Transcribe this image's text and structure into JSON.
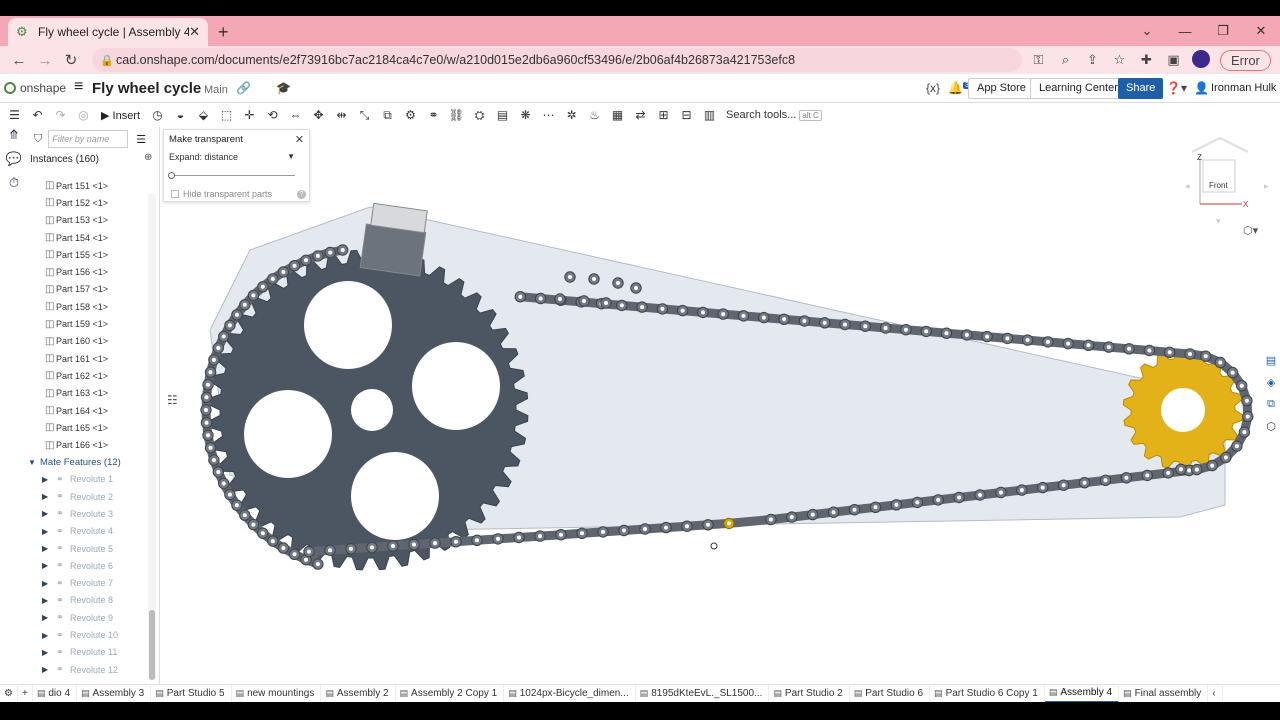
{
  "browser": {
    "tab_title": "Fly wheel cycle | Assembly 4",
    "url": "cad.onshape.com/documents/e2f73916bc7ac2184ca4c7e0/w/a210d015e2db6a960cf53496/e/2b06af4b26873a421753efc8",
    "error_label": "Error"
  },
  "app": {
    "logo": "onshape",
    "doc_title": "Fly wheel cycle",
    "branch": "Main",
    "notif_count": "3",
    "app_store": "App Store",
    "learning_center": "Learning Center",
    "share": "Share",
    "user": "Ironman Hulk"
  },
  "toolbar": {
    "insert": "Insert",
    "search_tools": "Search tools...",
    "search_kbd": "alt C"
  },
  "panel": {
    "filter_placeholder": "Filter by name",
    "instances": "Instances (160)",
    "parts": [
      "Part 151 <1>",
      "Part 152 <1>",
      "Part 153 <1>",
      "Part 154 <1>",
      "Part 155 <1>",
      "Part 156 <1>",
      "Part 157 <1>",
      "Part 158 <1>",
      "Part 159 <1>",
      "Part 160 <1>",
      "Part 161 <1>",
      "Part 162 <1>",
      "Part 163 <1>",
      "Part 164 <1>",
      "Part 165 <1>",
      "Part 166 <1>"
    ],
    "mate_features": "Mate Features (12)",
    "mates": [
      "Revolute 1",
      "Revolute 2",
      "Revolute 3",
      "Revolute 4",
      "Revolute 5",
      "Revolute 6",
      "Revolute 7",
      "Revolute 8",
      "Revolute 9",
      "Revolute 10",
      "Revolute 11",
      "Revolute 12"
    ]
  },
  "dialog": {
    "title": "Make transparent",
    "expand": "Expand: distance",
    "hide": "Hide transparent parts"
  },
  "viewcube": {
    "face": "Front",
    "z": "Z",
    "x": "X"
  },
  "tabs": [
    "dio 4",
    "Assembly 3",
    "Part Studio 5",
    "new mountings",
    "Assembly 2",
    "Assembly 2 Copy 1",
    "1024px-Bicycle_dimen...",
    "8195dKteEvL._SL1500...",
    "Part Studio 2",
    "Part Studio 6",
    "Part Studio 6 Copy 1",
    "Assembly 4",
    "Final assembly"
  ],
  "colors": {
    "tabbar": "#f4a7b5",
    "accent": "#1f5fa8",
    "sprocket": "#4c5663",
    "small_sprocket": "#e3b219"
  }
}
